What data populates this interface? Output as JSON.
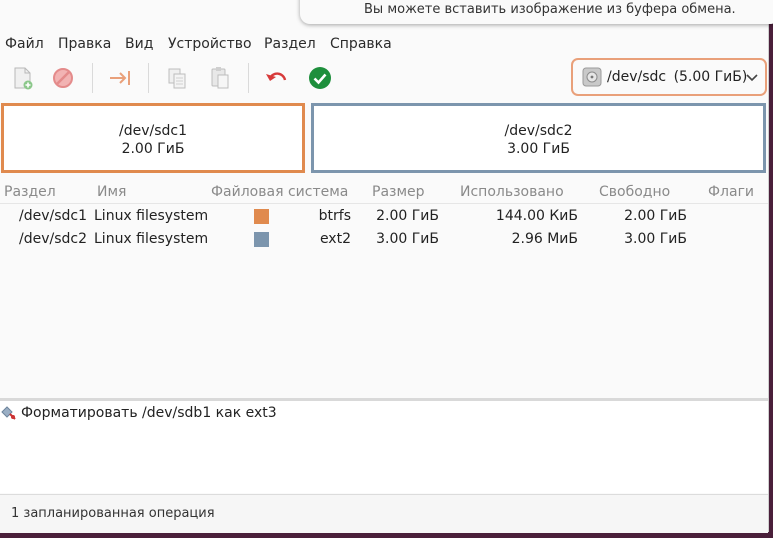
{
  "notification": {
    "text": "Вы можете вставить изображение из буфера обмена."
  },
  "menu": [
    "Файл",
    "Правка",
    "Вид",
    "Устройство",
    "Раздел",
    "Справка"
  ],
  "toolbar": {
    "icons": [
      "new-partition-icon",
      "delete-icon",
      "resize-move-icon",
      "copy-icon",
      "paste-icon",
      "undo-icon",
      "apply-icon"
    ],
    "device": {
      "label": "/dev/sdc",
      "size": "(5.00 ГиБ)"
    }
  },
  "graph": [
    {
      "name": "/dev/sdc1",
      "size": "2.00 ГиБ",
      "color": "#e08a4e"
    },
    {
      "name": "/dev/sdc2",
      "size": "3.00 ГиБ",
      "color": "#7c95ad"
    }
  ],
  "table": {
    "columns": [
      "Раздел",
      "Имя",
      "Файловая система",
      "Размер",
      "Использовано",
      "Свободно",
      "Флаги"
    ],
    "rows": [
      {
        "partition": "/dev/sdc1",
        "name": "Linux filesystem",
        "fs_color": "#e08a4e",
        "fs": "btrfs",
        "size": "2.00 ГиБ",
        "used": "144.00 КиБ",
        "free": "2.00 ГиБ",
        "flags": ""
      },
      {
        "partition": "/dev/sdc2",
        "name": "Linux filesystem",
        "fs_color": "#7c95ad",
        "fs": "ext2",
        "size": "3.00 ГиБ",
        "used": "2.96 МиБ",
        "free": "3.00 ГиБ",
        "flags": ""
      }
    ]
  },
  "operations": [
    {
      "text": "Форматировать /dev/sdb1 как ext3"
    }
  ],
  "status": {
    "text": "1 запланированная операция"
  }
}
